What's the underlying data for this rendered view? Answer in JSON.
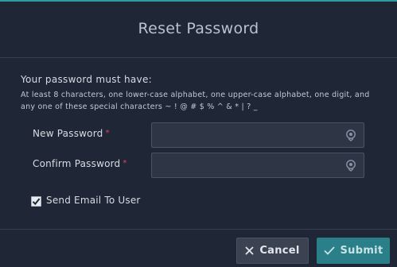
{
  "dialog": {
    "title": "Reset Password"
  },
  "requirements": {
    "heading": "Your password must have:",
    "text": "At least 8 characters, one lower-case alphabet, one upper-case alphabet, one digit, and any one of these special characters ~ ! @ # $ % ^ & * | ? _"
  },
  "fields": {
    "new_password": {
      "label": "New Password",
      "required_mark": "*",
      "value": "",
      "icon": "eye-reveal-icon"
    },
    "confirm_password": {
      "label": "Confirm Password",
      "required_mark": "*",
      "value": "",
      "icon": "eye-reveal-icon"
    }
  },
  "send_email": {
    "label": "Send Email To User",
    "checked": true
  },
  "buttons": {
    "cancel_label": "Cancel",
    "submit_label": "Submit"
  },
  "colors": {
    "accent": "#2a7f88",
    "required": "#e0455a",
    "background": "#1f2636"
  }
}
